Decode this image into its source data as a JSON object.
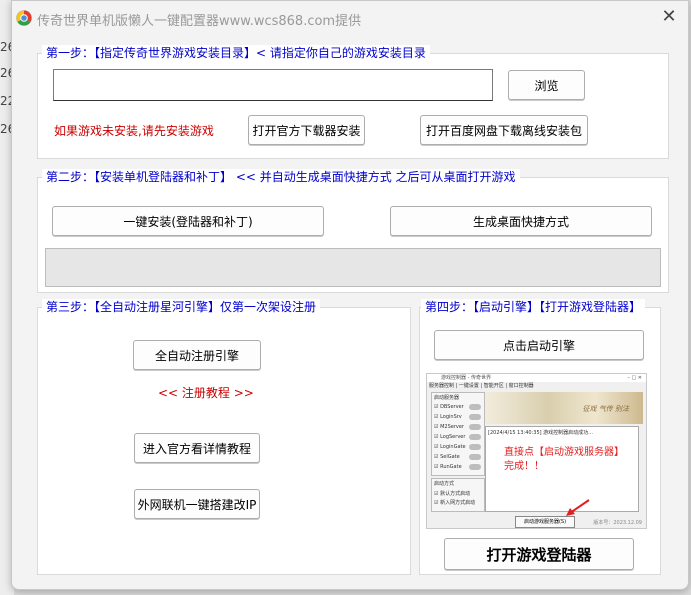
{
  "background": {
    "numbers": [
      "26",
      "26",
      "22",
      "26"
    ]
  },
  "window": {
    "title": "传奇世界单机版懒人一键配置器www.wcs868.com提供",
    "close_label": "✕"
  },
  "step1": {
    "title": "第一步：【指定传奇世界游戏安装目录】< 请指定你自己的游戏安装目录",
    "path_value": "",
    "browse_label": "浏览",
    "warning": "如果游戏未安装,请先安装游戏",
    "official_downloader_label": "打开官方下载器安装",
    "baidu_label": "打开百度网盘下载离线安装包"
  },
  "step2": {
    "title": "第二步：【安装单机登陆器和补丁】 <<   并自动生成桌面快捷方式 之后可从桌面打开游戏",
    "install_label": "一键安装(登陆器和补丁)",
    "shortcut_label": "生成桌面快捷方式",
    "progress": 0
  },
  "step3": {
    "title": "第三步：【全自动注册星河引擎】仅第一次架设注册",
    "register_label": "全自动注册引擎",
    "tutorial_label": "<< 注册教程 >>",
    "official_tutorial_label": "进入官方看详情教程",
    "wan_label": "外网联机一键搭建改IP"
  },
  "step4": {
    "title": "第四步：【启动引擎】【打开游戏登陆器】",
    "start_engine_label": "点击启动引擎",
    "open_login_label": "打开游戏登陆器",
    "screenshot": {
      "window_title": "游戏控制器 - 传奇世界",
      "tabs": [
        "服务器控制",
        "一键设置",
        "智能开区",
        "窗口控制器"
      ],
      "group_label": "启动服务器",
      "servers": [
        "DBServer",
        "LoginSrv",
        "M2Server",
        "LogServer",
        "LoginGate",
        "SelGate",
        "RunGate"
      ],
      "log_line": "[2024/4/15 13:40:35] 游戏控制器启动成功...",
      "note": "直接点【启动游戏服务器】完成！！",
      "mode_label": "启动方式",
      "modes": [
        "默认方式启动",
        "新入网方式启动"
      ],
      "start_button_label": "启动游戏服务器(S)",
      "version_text": "版本号：2023.12.09",
      "banner_text": "征戏 气传 别法"
    }
  },
  "colors": {
    "title_blue": "#0000cc",
    "warning_red": "#cc0000",
    "progress_green": "#06b025"
  }
}
